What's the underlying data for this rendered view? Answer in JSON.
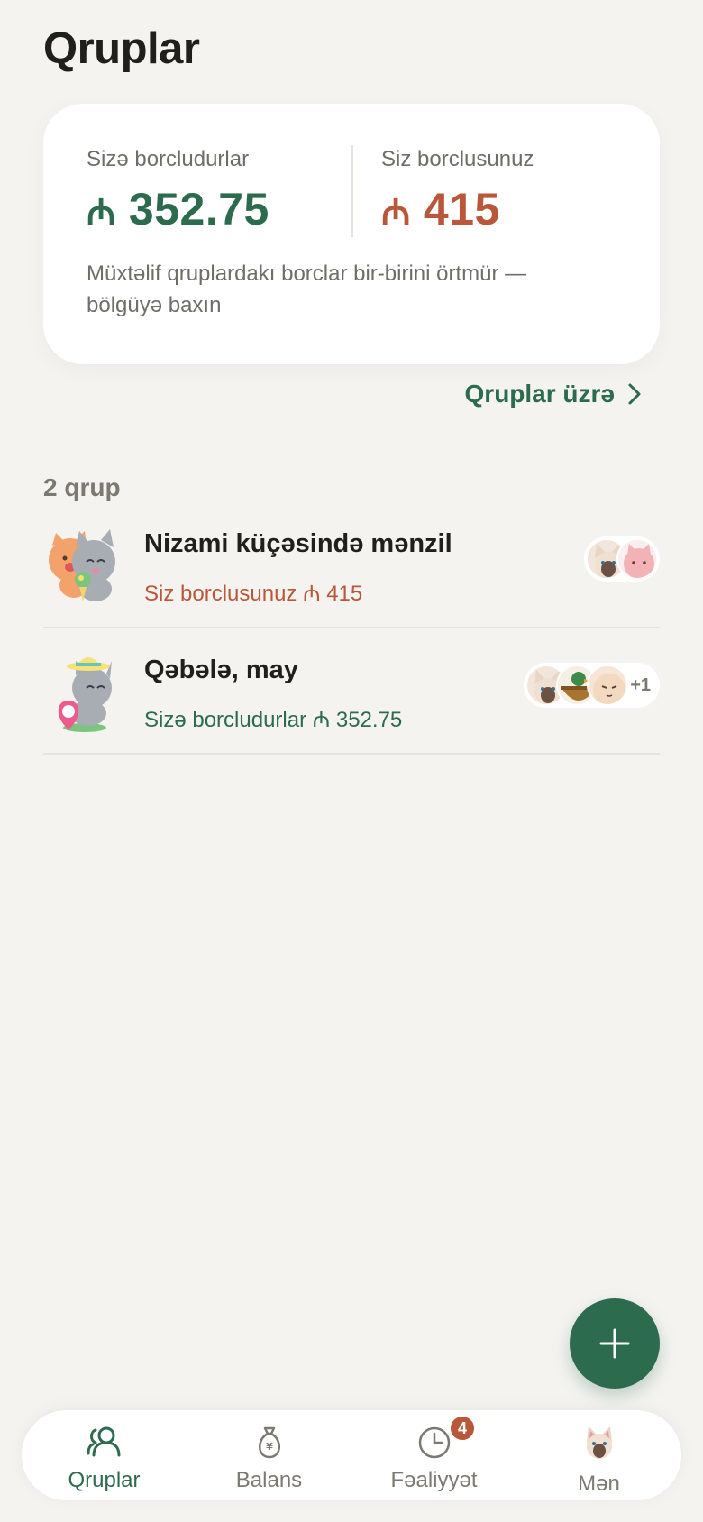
{
  "page": {
    "title": "Qruplar"
  },
  "summary": {
    "owed_to_you_label": "Sizə borcludurlar",
    "owed_to_you_currency": "₼",
    "owed_to_you_amount": "352.75",
    "you_owe_label": "Siz borclusunuz",
    "you_owe_currency": "₼",
    "you_owe_amount": "415",
    "note": "Müxtəlif qruplardakı borclar bir-birini örtmür — bölgüyə baxın"
  },
  "by_groups_link": {
    "label": "Qruplar üzrə"
  },
  "groups": {
    "count_label": "2 qrup",
    "items": [
      {
        "name": "Nizami küçəsində mənzil",
        "status": "Siz borclusunuz ₼ 415",
        "status_kind": "owe",
        "member_icons": [
          "cat-avatar-siamese",
          "cat-avatar-pink"
        ]
      },
      {
        "name": "Qəbələ, may",
        "status": "Sizə borcludurlar ₼ 352.75",
        "status_kind": "owed",
        "member_icons": [
          "cat-avatar-siamese",
          "duck-in-bowl-avatar",
          "cat-avatar-cream"
        ],
        "more_count": "+1"
      }
    ]
  },
  "fab": {
    "icon": "plus-icon"
  },
  "tabbar": {
    "tabs": [
      {
        "label": "Qruplar",
        "icon": "people-icon",
        "active": true
      },
      {
        "label": "Balans",
        "icon": "money-bag-icon"
      },
      {
        "label": "Fəaliyyət",
        "icon": "clock-icon",
        "badge": "4"
      },
      {
        "label": "Mən",
        "icon": "profile-avatar"
      }
    ]
  },
  "colors": {
    "accent_green": "#2d6b4f",
    "accent_rust": "#b9573a",
    "background": "#f4f3f0",
    "card": "#ffffff"
  }
}
